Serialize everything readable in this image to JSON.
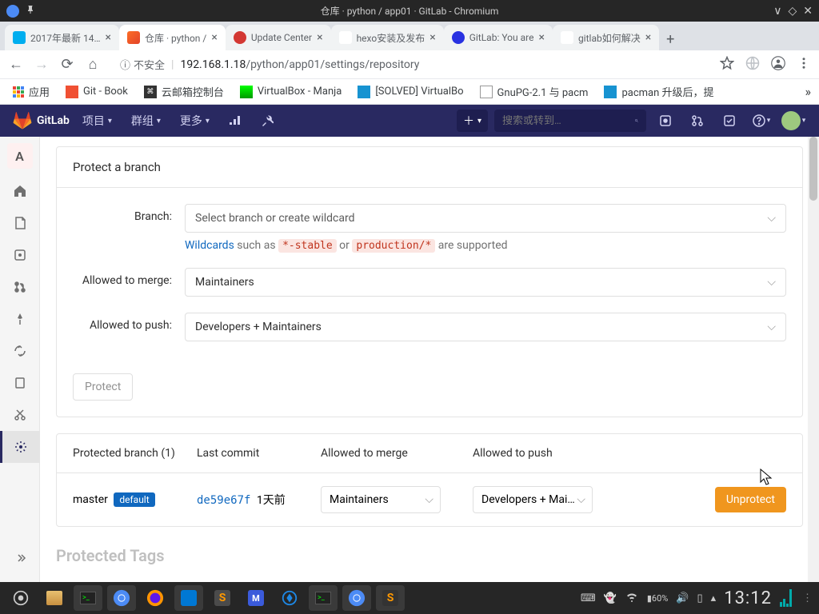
{
  "os": {
    "title": "仓库 · python / app01 · GitLab - Chromium",
    "win_min": "∨",
    "win_max": "◇",
    "win_close": "✕"
  },
  "browser_tabs": [
    {
      "title": "2017年最新 14…",
      "active": false
    },
    {
      "title": "仓库 · python /",
      "active": true
    },
    {
      "title": "Update Center",
      "active": false
    },
    {
      "title": "hexo安装及发布",
      "active": false
    },
    {
      "title": "GitLab: You are",
      "active": false
    },
    {
      "title": "gitlab如何解决",
      "active": false
    }
  ],
  "addr": {
    "insecure": "不安全",
    "host": "192.168.1.18",
    "path": "/python/app01/settings/repository"
  },
  "bookmarks": [
    {
      "label": "应用"
    },
    {
      "label": "Git - Book"
    },
    {
      "label": "云邮箱控制台"
    },
    {
      "label": "VirtualBox - Manja"
    },
    {
      "label": "[SOLVED] VirtualBo"
    },
    {
      "label": "GnuPG-2.1 与 pacm"
    },
    {
      "label": "pacman 升级后，提"
    }
  ],
  "gl_nav": {
    "brand": "GitLab",
    "items": [
      "项目",
      "群组",
      "更多"
    ],
    "search_placeholder": "搜索或转到…"
  },
  "sidebar": {
    "project_letter": "A"
  },
  "card": {
    "title": "Protect a branch",
    "branch_label": "Branch:",
    "branch_placeholder": "Select branch or create wildcard",
    "wildcards_link": "Wildcards",
    "wildcards_mid": " such as ",
    "wc_ex1": "*-stable",
    "wc_or": " or ",
    "wc_ex2": "production/*",
    "wc_tail": " are supported",
    "merge_label": "Allowed to merge:",
    "merge_value": "Maintainers",
    "push_label": "Allowed to push:",
    "push_value": "Developers + Maintainers",
    "protect_btn": "Protect"
  },
  "table": {
    "h1": "Protected branch (1)",
    "h2": "Last commit",
    "h3": "Allowed to merge",
    "h4": "Allowed to push",
    "row": {
      "branch": "master",
      "badge": "default",
      "commit": "de59e67f",
      "commit_time": "1天前",
      "merge": "Maintainers",
      "push": "Developers + Mai…",
      "action": "Unprotect"
    }
  },
  "next_section": "Protected Tags",
  "taskbar": {
    "time": "13:12"
  }
}
